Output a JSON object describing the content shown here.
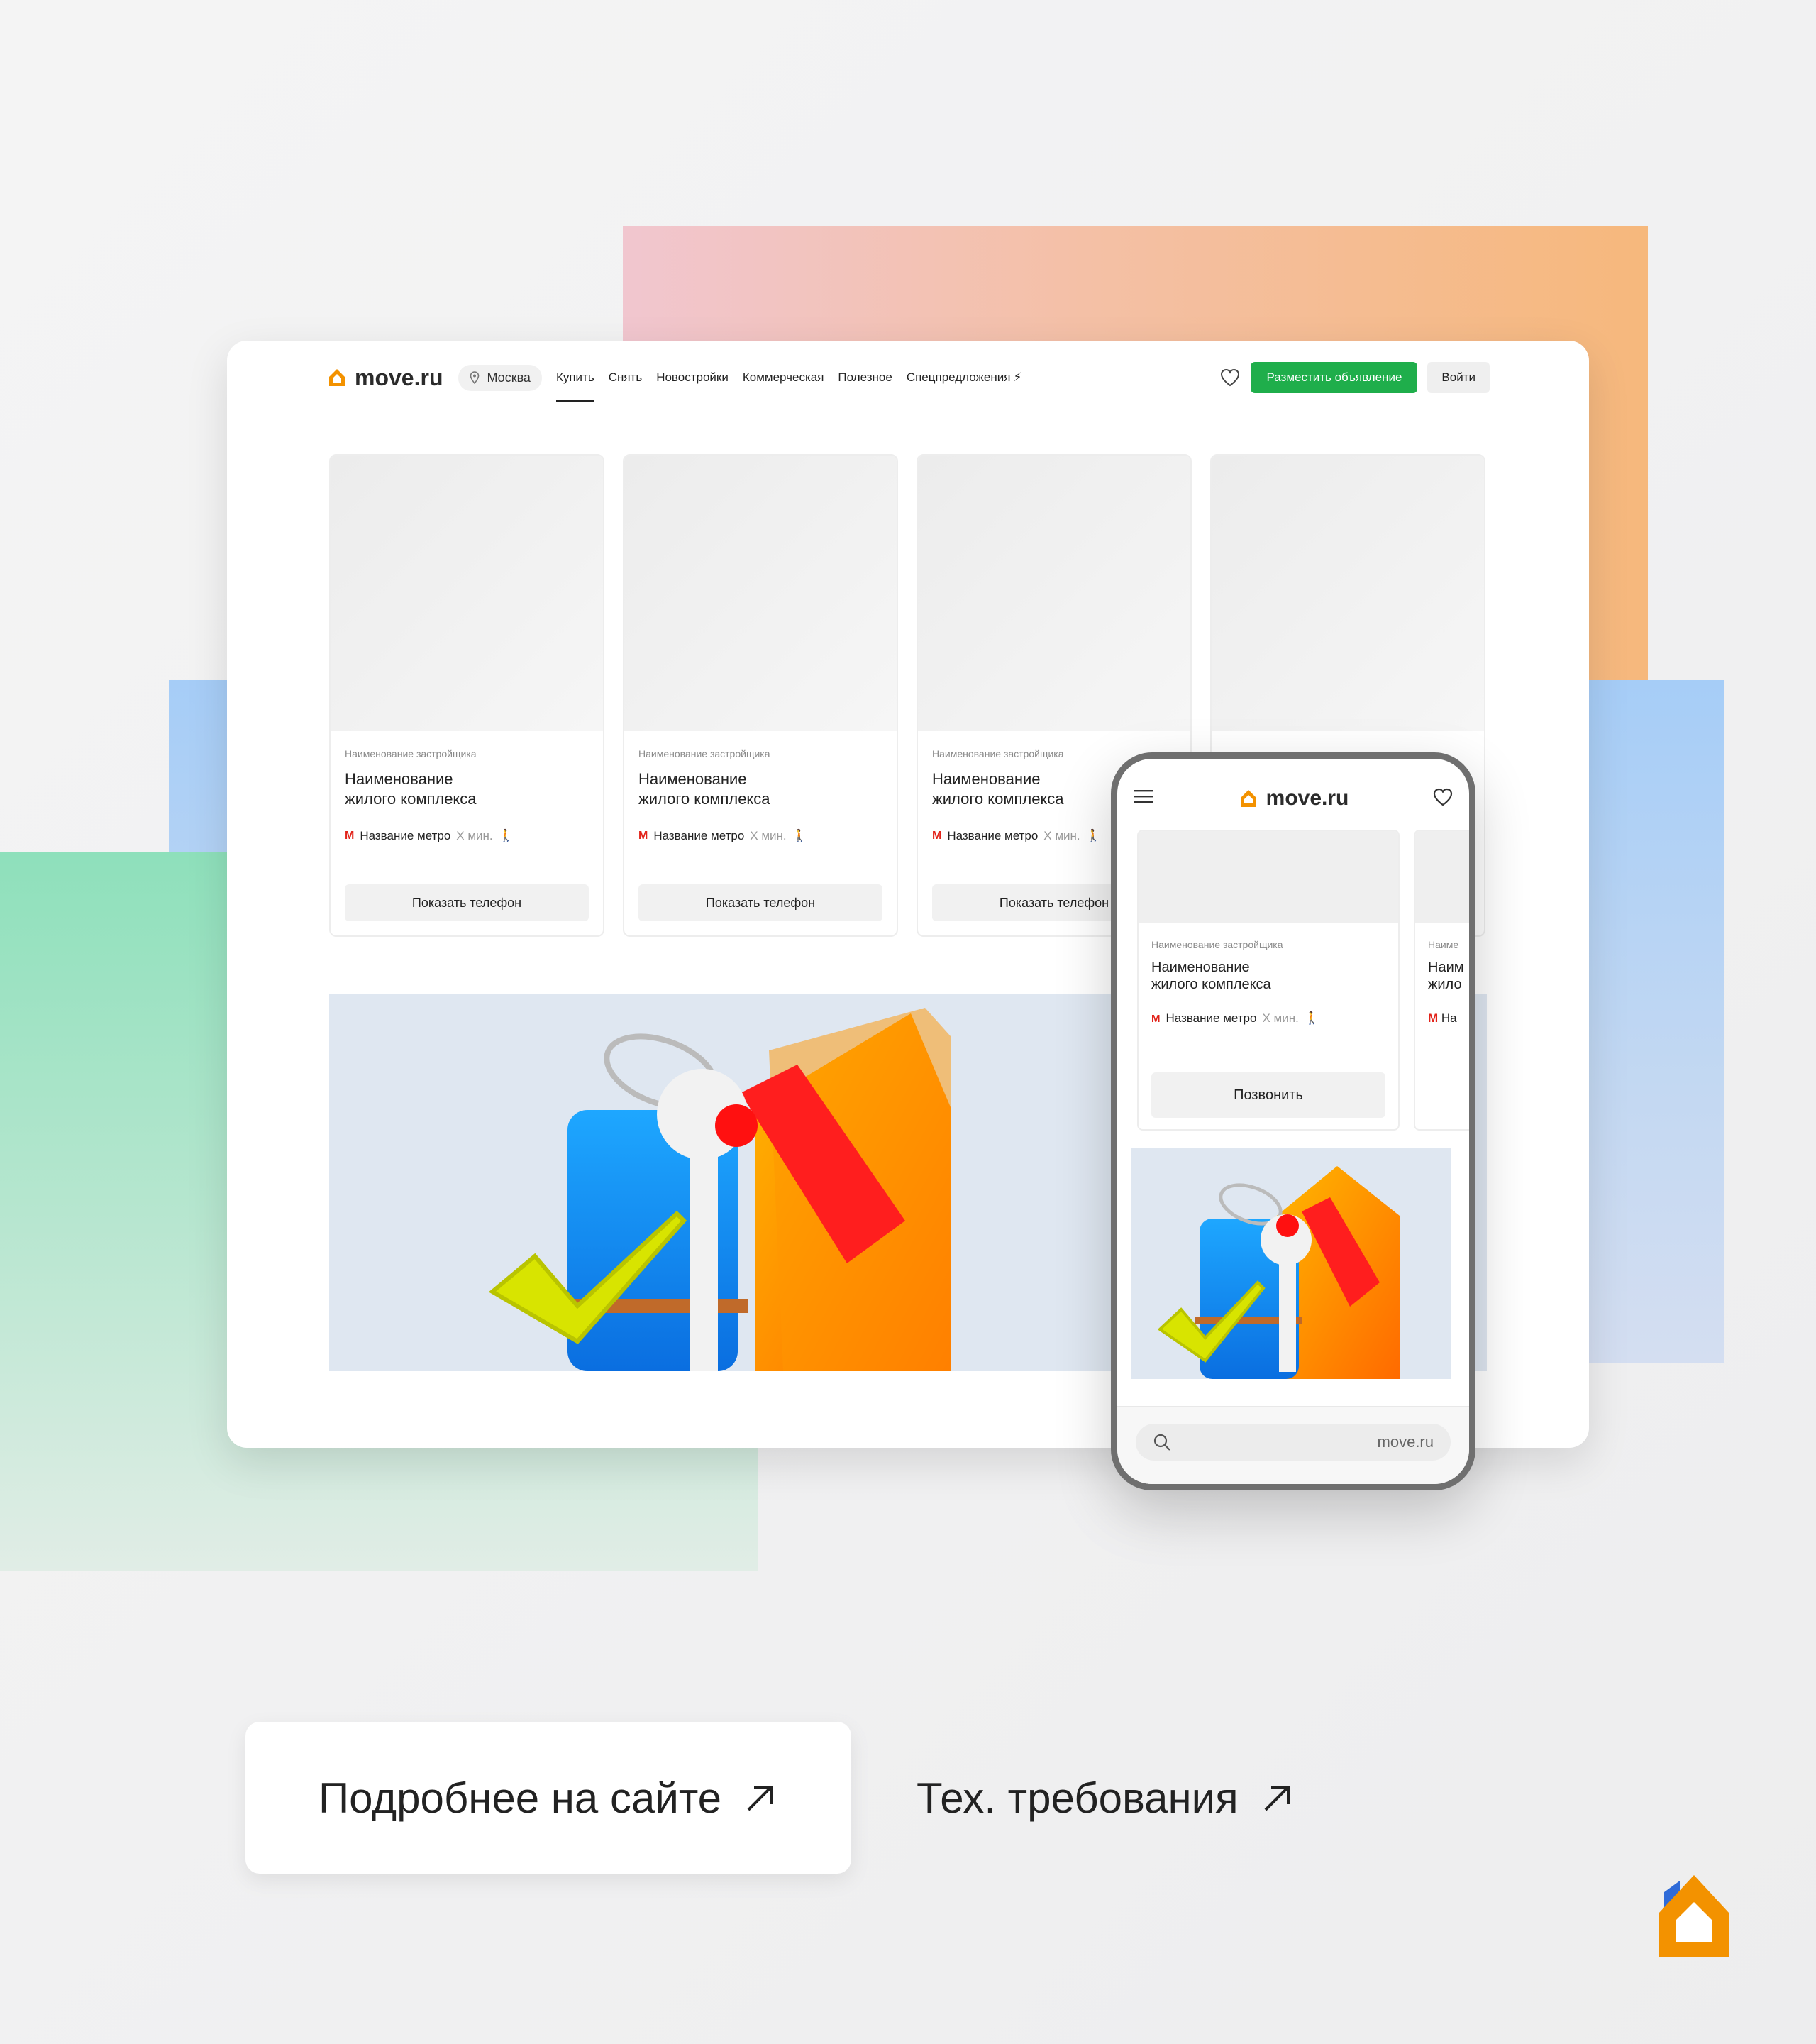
{
  "brand": {
    "name": "move.ru",
    "accent": "#f39200",
    "green": "#1fae4b",
    "metro_red": "#e2231a"
  },
  "desktop": {
    "city": "Москва",
    "nav": [
      "Купить",
      "Снять",
      "Новостройки",
      "Коммерческая",
      "Полезное",
      "Спецпредложения"
    ],
    "active_nav": "Купить",
    "post_button": "Разместить объявление",
    "login_button": "Войти",
    "cards": [
      {
        "developer": "Наименование застройщика",
        "name": "Наименование\nжилого комплекса",
        "metro": "Название метро",
        "mins": "Х мин.",
        "button": "Показать телефон"
      },
      {
        "developer": "Наименование застройщика",
        "name": "Наименование\nжилого комплекса",
        "metro": "Название метро",
        "mins": "Х мин.",
        "button": "Показать телефон"
      },
      {
        "developer": "Наименование застройщика",
        "name": "Наименование\nжилого комплекса",
        "metro": "Название метро",
        "mins": "Х мин.",
        "button": "Показать телефон"
      }
    ]
  },
  "phone": {
    "card": {
      "developer": "Наименование застройщика",
      "name": "Наименование\nжилого комплекса",
      "metro": "Название метро",
      "mins": "Х мин.",
      "button": "Позвонить"
    },
    "card2": {
      "developer": "Наиме",
      "name_1": "Наим",
      "name_2": "жило",
      "metro": "На"
    },
    "url": "move.ru"
  },
  "cta": {
    "site": "Подробнее на сайте",
    "tech": "Тех. требования"
  },
  "icons": [
    "location-pin-icon",
    "heart-icon",
    "menu-icon",
    "search-icon",
    "metro-icon",
    "walking-icon",
    "arrow-up-right-icon",
    "brand-logo-icon"
  ]
}
